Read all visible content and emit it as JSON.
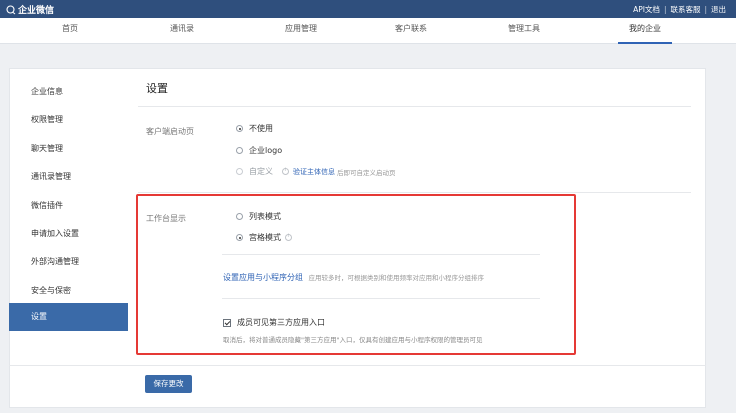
{
  "topbar": {
    "logo_text": "企业微信",
    "links": [
      "API文档",
      "联系客服",
      "退出"
    ]
  },
  "nav": {
    "items": [
      "首页",
      "通讯录",
      "应用管理",
      "客户联系",
      "管理工具",
      "我的企业"
    ],
    "active_index": 5
  },
  "sidebar": {
    "items": [
      "企业信息",
      "权限管理",
      "聊天管理",
      "通讯录管理",
      "微信插件",
      "申请加入设置",
      "外部沟通管理",
      "安全与保密",
      "设置"
    ],
    "active_index": 8
  },
  "main": {
    "title": "设置",
    "client_start": {
      "label": "客户端启动页",
      "options": [
        "不使用",
        "企业logo",
        "自定义"
      ],
      "selected": 0,
      "verify_link": "验证主体信息",
      "verify_hint": "后即可自定义启动页"
    },
    "workbench": {
      "label": "工作台显示",
      "options": [
        "列表模式",
        "宫格模式"
      ],
      "selected": 1,
      "group_link": "设置应用与小程序分组",
      "group_hint": "应用较多时，可根据类别和使用频率对应用和小程序分组排序",
      "checkbox_label": "成员可见第三方应用入口",
      "checkbox_checked": true,
      "checkbox_desc": "取消后，将对普通成员隐藏\"第三方应用\"入口，仅具有创建应用与小程序权限的管理员可见"
    },
    "save_label": "保存更改"
  },
  "colors": {
    "topbar": "#2f4f7d",
    "accent": "#3a6aa8",
    "link": "#2f63b5",
    "highlight": "#e53935"
  }
}
